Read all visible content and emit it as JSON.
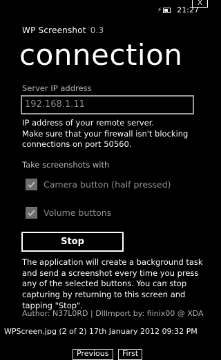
{
  "status": {
    "time": "21:27",
    "battery_icon": "battery-charging-icon"
  },
  "close_label": "X",
  "app": {
    "name": "WP Screenshot",
    "version": "0.3"
  },
  "page_title": "connection",
  "server": {
    "label": "Server IP address",
    "value": "192.168.1.11",
    "info": [
      "IP address of your remote server.",
      "Make sure that your firewall isn't blocking",
      "connections on port 50560."
    ]
  },
  "take": {
    "label": "Take screenshots with",
    "options": [
      {
        "label": "Camera button (half pressed)",
        "checked": true
      },
      {
        "label": "Volume buttons",
        "checked": true
      }
    ]
  },
  "stop_label": "Stop",
  "description": "The application will create a background task and send a screenshot every time you press any of the selected buttons. You can stop capturing by returning to this screen and tapping \"Stop\".",
  "author": "Author: N37L0RD | DllImport by: fiinix00 @ XDA",
  "viewer": {
    "caption": "WPScreen.jpg (2 of 2)  17th January 2012 09:32 PM",
    "prev_label": "Previous",
    "first_label": "First"
  },
  "colors": {
    "background": "#000000",
    "foreground": "#ffffff",
    "disabled": "#8e8e8e"
  }
}
